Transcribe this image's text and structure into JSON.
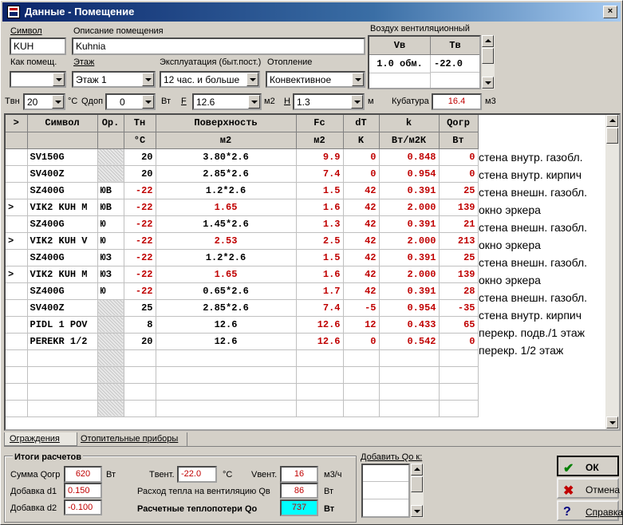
{
  "window": {
    "title": "Данные - Помещение",
    "close": "×"
  },
  "header": {
    "symbol_label": "Символ",
    "symbol_value": "KUH",
    "desc_label": "Описание помещения",
    "desc_value": "Kuhnia",
    "kak_label": "Как помещ.",
    "kak_value": "",
    "etazh_label": "Этаж",
    "etazh_value": "Этаж 1",
    "expl_label": "Эксплуатация (быт.пост.)",
    "expl_value": "12 час. и больше",
    "otop_label": "Отопление",
    "otop_value": "Конвективное",
    "air_label": "Воздух вентиляционный",
    "air_vv": "Vв",
    "air_tv": "Tв",
    "air_vv_value": "1.0 обм.",
    "air_tv_value": "-22.0"
  },
  "params": {
    "tvn_label": "Tвн",
    "tvn_value": "20",
    "tvn_unit": "°C",
    "qdop_label": "Qдоп",
    "qdop_value": "0",
    "qdop_unit": "Вт",
    "f_label": "F",
    "f_value": "12.6",
    "f_unit": "м2",
    "h_label": "H",
    "h_value": "1.3",
    "h_unit": "м",
    "kub_label": "Кубатура",
    "kub_value": "16.4",
    "kub_unit": "м3"
  },
  "table": {
    "headers": [
      ">",
      "Символ",
      "Ор.",
      "Tн",
      "Поверхность",
      "Fc",
      "dT",
      "k",
      "Qогр"
    ],
    "units": [
      "",
      "",
      "",
      "°C",
      "м2",
      "м2",
      "K",
      "Вт/м2К",
      "Вт"
    ],
    "rows": [
      {
        "mark": "",
        "sym": "SV150G",
        "or": "",
        "tn": "20",
        "surf": "3.80*2.6",
        "fc": "9.9",
        "dt": "0",
        "k": "0.848",
        "q": "0",
        "desc": "стена внутр. газобл."
      },
      {
        "mark": "",
        "sym": "SV400Z",
        "or": "",
        "tn": "20",
        "surf": "2.85*2.6",
        "fc": "7.4",
        "dt": "0",
        "k": "0.954",
        "q": "0",
        "desc": "стена внутр. кирпич"
      },
      {
        "mark": "",
        "sym": "SZ400G",
        "or": "ЮВ",
        "tn": "-22",
        "surf": "1.2*2.6",
        "fc": "1.5",
        "dt": "42",
        "k": "0.391",
        "q": "25",
        "desc": "стена внешн. газобл."
      },
      {
        "mark": ">",
        "sym": "VIK2 KUH M",
        "or": "ЮВ",
        "tn": "-22",
        "surf": "1.65",
        "fc": "1.6",
        "dt": "42",
        "k": "2.000",
        "q": "139",
        "desc": "окно эркера"
      },
      {
        "mark": "",
        "sym": "SZ400G",
        "or": "Ю",
        "tn": "-22",
        "surf": "1.45*2.6",
        "fc": "1.3",
        "dt": "42",
        "k": "0.391",
        "q": "21",
        "desc": "стена внешн. газобл."
      },
      {
        "mark": ">",
        "sym": "VIK2 KUH V",
        "or": "Ю",
        "tn": "-22",
        "surf": "2.53",
        "fc": "2.5",
        "dt": "42",
        "k": "2.000",
        "q": "213",
        "desc": "окно эркера"
      },
      {
        "mark": "",
        "sym": "SZ400G",
        "or": "ЮЗ",
        "tn": "-22",
        "surf": "1.2*2.6",
        "fc": "1.5",
        "dt": "42",
        "k": "0.391",
        "q": "25",
        "desc": "стена внешн. газобл."
      },
      {
        "mark": ">",
        "sym": "VIK2 KUH M",
        "or": "ЮЗ",
        "tn": "-22",
        "surf": "1.65",
        "fc": "1.6",
        "dt": "42",
        "k": "2.000",
        "q": "139",
        "desc": "окно эркера"
      },
      {
        "mark": "",
        "sym": "SZ400G",
        "or": "Ю",
        "tn": "-22",
        "surf": "0.65*2.6",
        "fc": "1.7",
        "dt": "42",
        "k": "0.391",
        "q": "28",
        "desc": "стена внешн. газобл."
      },
      {
        "mark": "",
        "sym": "SV400Z",
        "or": "",
        "tn": "25",
        "surf": "2.85*2.6",
        "fc": "7.4",
        "dt": "-5",
        "k": "0.954",
        "q": "-35",
        "desc": "стена внутр. кирпич"
      },
      {
        "mark": "",
        "sym": "PIDL 1 POV",
        "or": "",
        "tn": "8",
        "surf": "12.6",
        "fc": "12.6",
        "dt": "12",
        "k": "0.433",
        "q": "65",
        "desc": "перекр. подв./1 этаж"
      },
      {
        "mark": "",
        "sym": "PEREKR 1/2",
        "or": "",
        "tn": "20",
        "surf": "12.6",
        "fc": "12.6",
        "dt": "0",
        "k": "0.542",
        "q": "0",
        "desc": "перекр. 1/2 этаж"
      }
    ]
  },
  "tabs": [
    "Ограждения",
    "Отопительные приборы"
  ],
  "summary": {
    "title": "Итоги расчетов",
    "sum_label": "Сумма Qогр",
    "sum_value": "620",
    "sum_unit": "Вт",
    "d1_label": "Добавка d1",
    "d1_value": "0.150",
    "d2_label": "Добавка d2",
    "d2_value": "-0.100",
    "tvent_label": "Tвент.",
    "tvent_value": "-22.0",
    "tvent_unit": "°C",
    "vvent_label": "Vвент.",
    "vvent_value": "16",
    "vvent_unit": "м3/ч",
    "qv_label": "Расход тепла на вентиляцию Qв",
    "qv_value": "86",
    "qv_unit": "Вт",
    "qo_label": "Расчетные теплопотери Qо",
    "qo_value": "737",
    "qo_unit": "Вт"
  },
  "add_label": "Добавить Qо к:",
  "buttons": {
    "ok": "ОК",
    "cancel": "Отмена",
    "help": "Справка"
  },
  "colors": {
    "accent_red": "#c00000",
    "highlight": "#00ffff",
    "title_blue": "#0a246a"
  }
}
